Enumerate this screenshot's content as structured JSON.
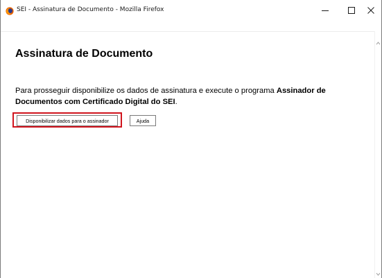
{
  "window": {
    "title": "SEI - Assinatura de Documento - Mozilla Firefox",
    "app_icon": "firefox-icon",
    "controls": {
      "minimize_icon": "minimize-icon",
      "maximize_icon": "maximize-icon",
      "close_icon": "close-icon"
    }
  },
  "page": {
    "heading": "Assinatura de Documento",
    "instruction_prefix": "Para prosseguir disponibilize os dados de assinatura e execute o programa ",
    "instruction_bold": "Assinador de Documentos com Certificado Digital do SEI",
    "instruction_suffix": ".",
    "buttons": {
      "provide_data_label": "Disponibilizar dados para o assinador",
      "help_label": "Ajuda"
    }
  },
  "colors": {
    "highlight_border": "#d0141d",
    "button_border": "#7a7a7a"
  }
}
